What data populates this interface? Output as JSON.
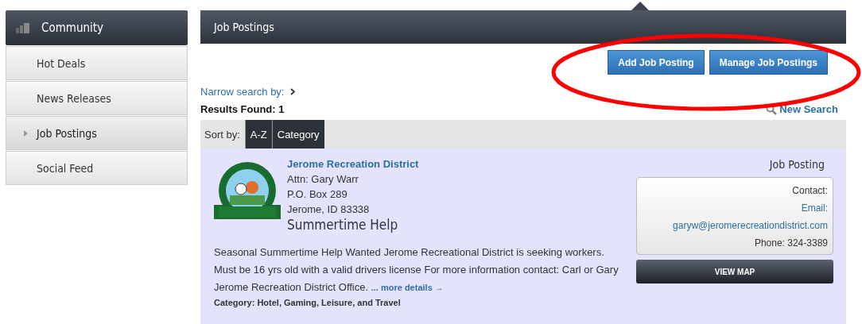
{
  "sidebar": {
    "header": "Community",
    "items": [
      {
        "label": "Hot Deals",
        "selected": false
      },
      {
        "label": "News Releases",
        "selected": false
      },
      {
        "label": "Job Postings",
        "selected": true
      },
      {
        "label": "Social Feed",
        "selected": false
      }
    ]
  },
  "panel": {
    "title": "Job Postings",
    "actions": [
      "Add Job Posting",
      "Manage Job Postings"
    ],
    "narrow_label": "Narrow search by:",
    "results": "Results Found: 1",
    "new_search": "New Search",
    "sort_label": "Sort by:",
    "sort_options": [
      {
        "label": "A-Z",
        "selected": false
      },
      {
        "label": "Category",
        "selected": false
      }
    ]
  },
  "listing": {
    "org": "Jerome Recreation District",
    "address": [
      "Attn: Gary Warr",
      "P.O. Box 289",
      "Jerome, ID 83338"
    ],
    "title": "Summertime Help",
    "description": "Seasonal Summertime Help Wanted Jerome Recreational District is seeking workers. Must be 16 yrs old with a valid drivers license For more information contact: Carl or Gary Jerome Recreation District Office.",
    "more": "... more details →",
    "category": "Category: Hotel, Gaming, Leisure, and Travel",
    "type": "Job Posting",
    "contact_label": "Contact:",
    "email_label": "Email:",
    "email": "garyw@jeromerecreationdistrict.com",
    "phone": "Phone: 324-3389",
    "map_button": "VIEW MAP"
  }
}
